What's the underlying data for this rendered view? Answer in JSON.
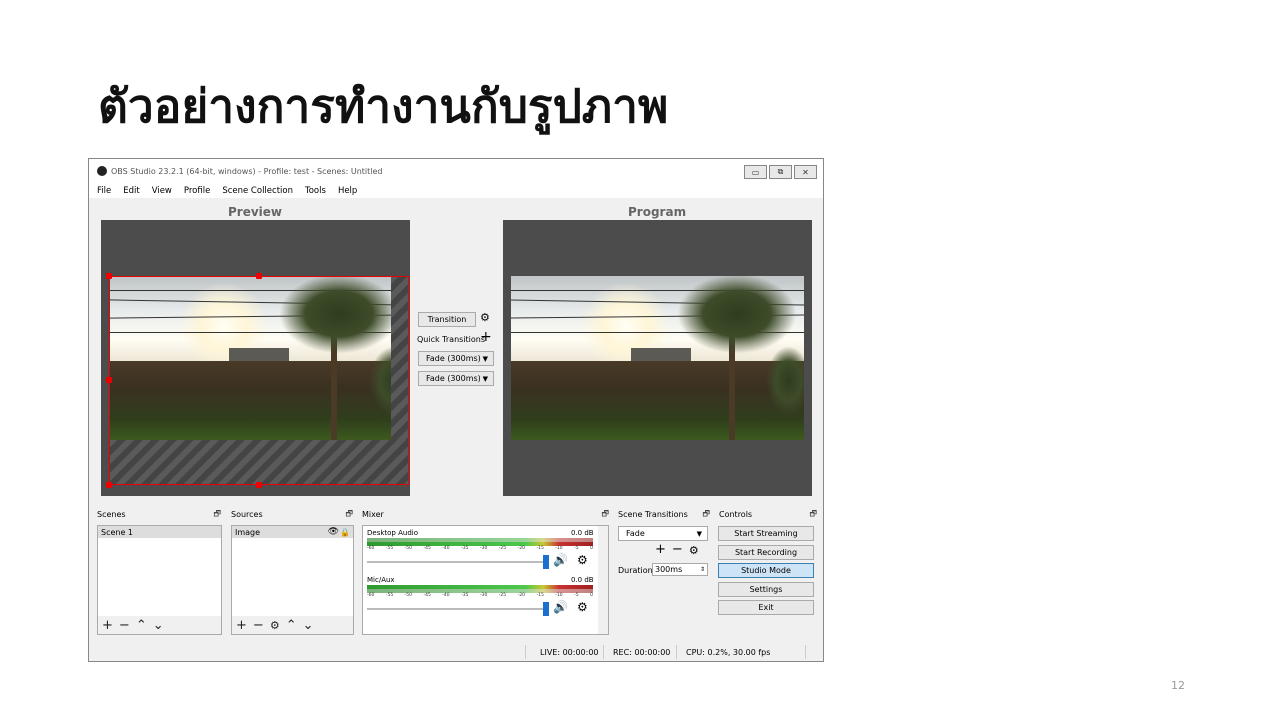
{
  "slide": {
    "title": "ตัวอย่างการทำงานกับรูปภาพ",
    "page_number": "12"
  },
  "window": {
    "title": "OBS Studio 23.2.1 (64-bit, windows) - Profile: test - Scenes: Untitled",
    "menu": [
      "File",
      "Edit",
      "View",
      "Profile",
      "Scene Collection",
      "Tools",
      "Help"
    ],
    "buttons": {
      "minimize": "▭",
      "restore": "⧉",
      "close": "✕"
    }
  },
  "studio": {
    "preview_label": "Preview",
    "program_label": "Program",
    "transition_button": "Transition",
    "quick_transitions_label": "Quick Transitions",
    "quick_transitions": [
      "Fade (300ms)",
      "Fade (300ms)"
    ]
  },
  "docks": {
    "scenes": {
      "title": "Scenes",
      "items": [
        "Scene 1"
      ]
    },
    "sources": {
      "title": "Sources",
      "items": [
        "Image"
      ]
    },
    "mixer": {
      "title": "Mixer",
      "tracks": [
        {
          "name": "Desktop Audio",
          "level": "0.0 dB"
        },
        {
          "name": "Mic/Aux",
          "level": "0.0 dB"
        }
      ],
      "scale": [
        "-60",
        "-55",
        "-50",
        "-45",
        "-40",
        "-35",
        "-30",
        "-25",
        "-20",
        "-15",
        "-10",
        "-5",
        "0"
      ]
    },
    "scene_transitions": {
      "title": "Scene Transitions",
      "selected": "Fade",
      "duration_label": "Duration",
      "duration_value": "300ms"
    },
    "controls": {
      "title": "Controls",
      "buttons": [
        "Start Streaming",
        "Start Recording",
        "Studio Mode",
        "Settings",
        "Exit"
      ]
    }
  },
  "status": {
    "live": "LIVE: 00:00:00",
    "rec": "REC: 00:00:00",
    "cpu": "CPU: 0.2%, 30.00 fps"
  },
  "colors": {
    "selection": "#e00000",
    "canvas": "#4c4c4c",
    "active_button": "#cde4f7"
  }
}
